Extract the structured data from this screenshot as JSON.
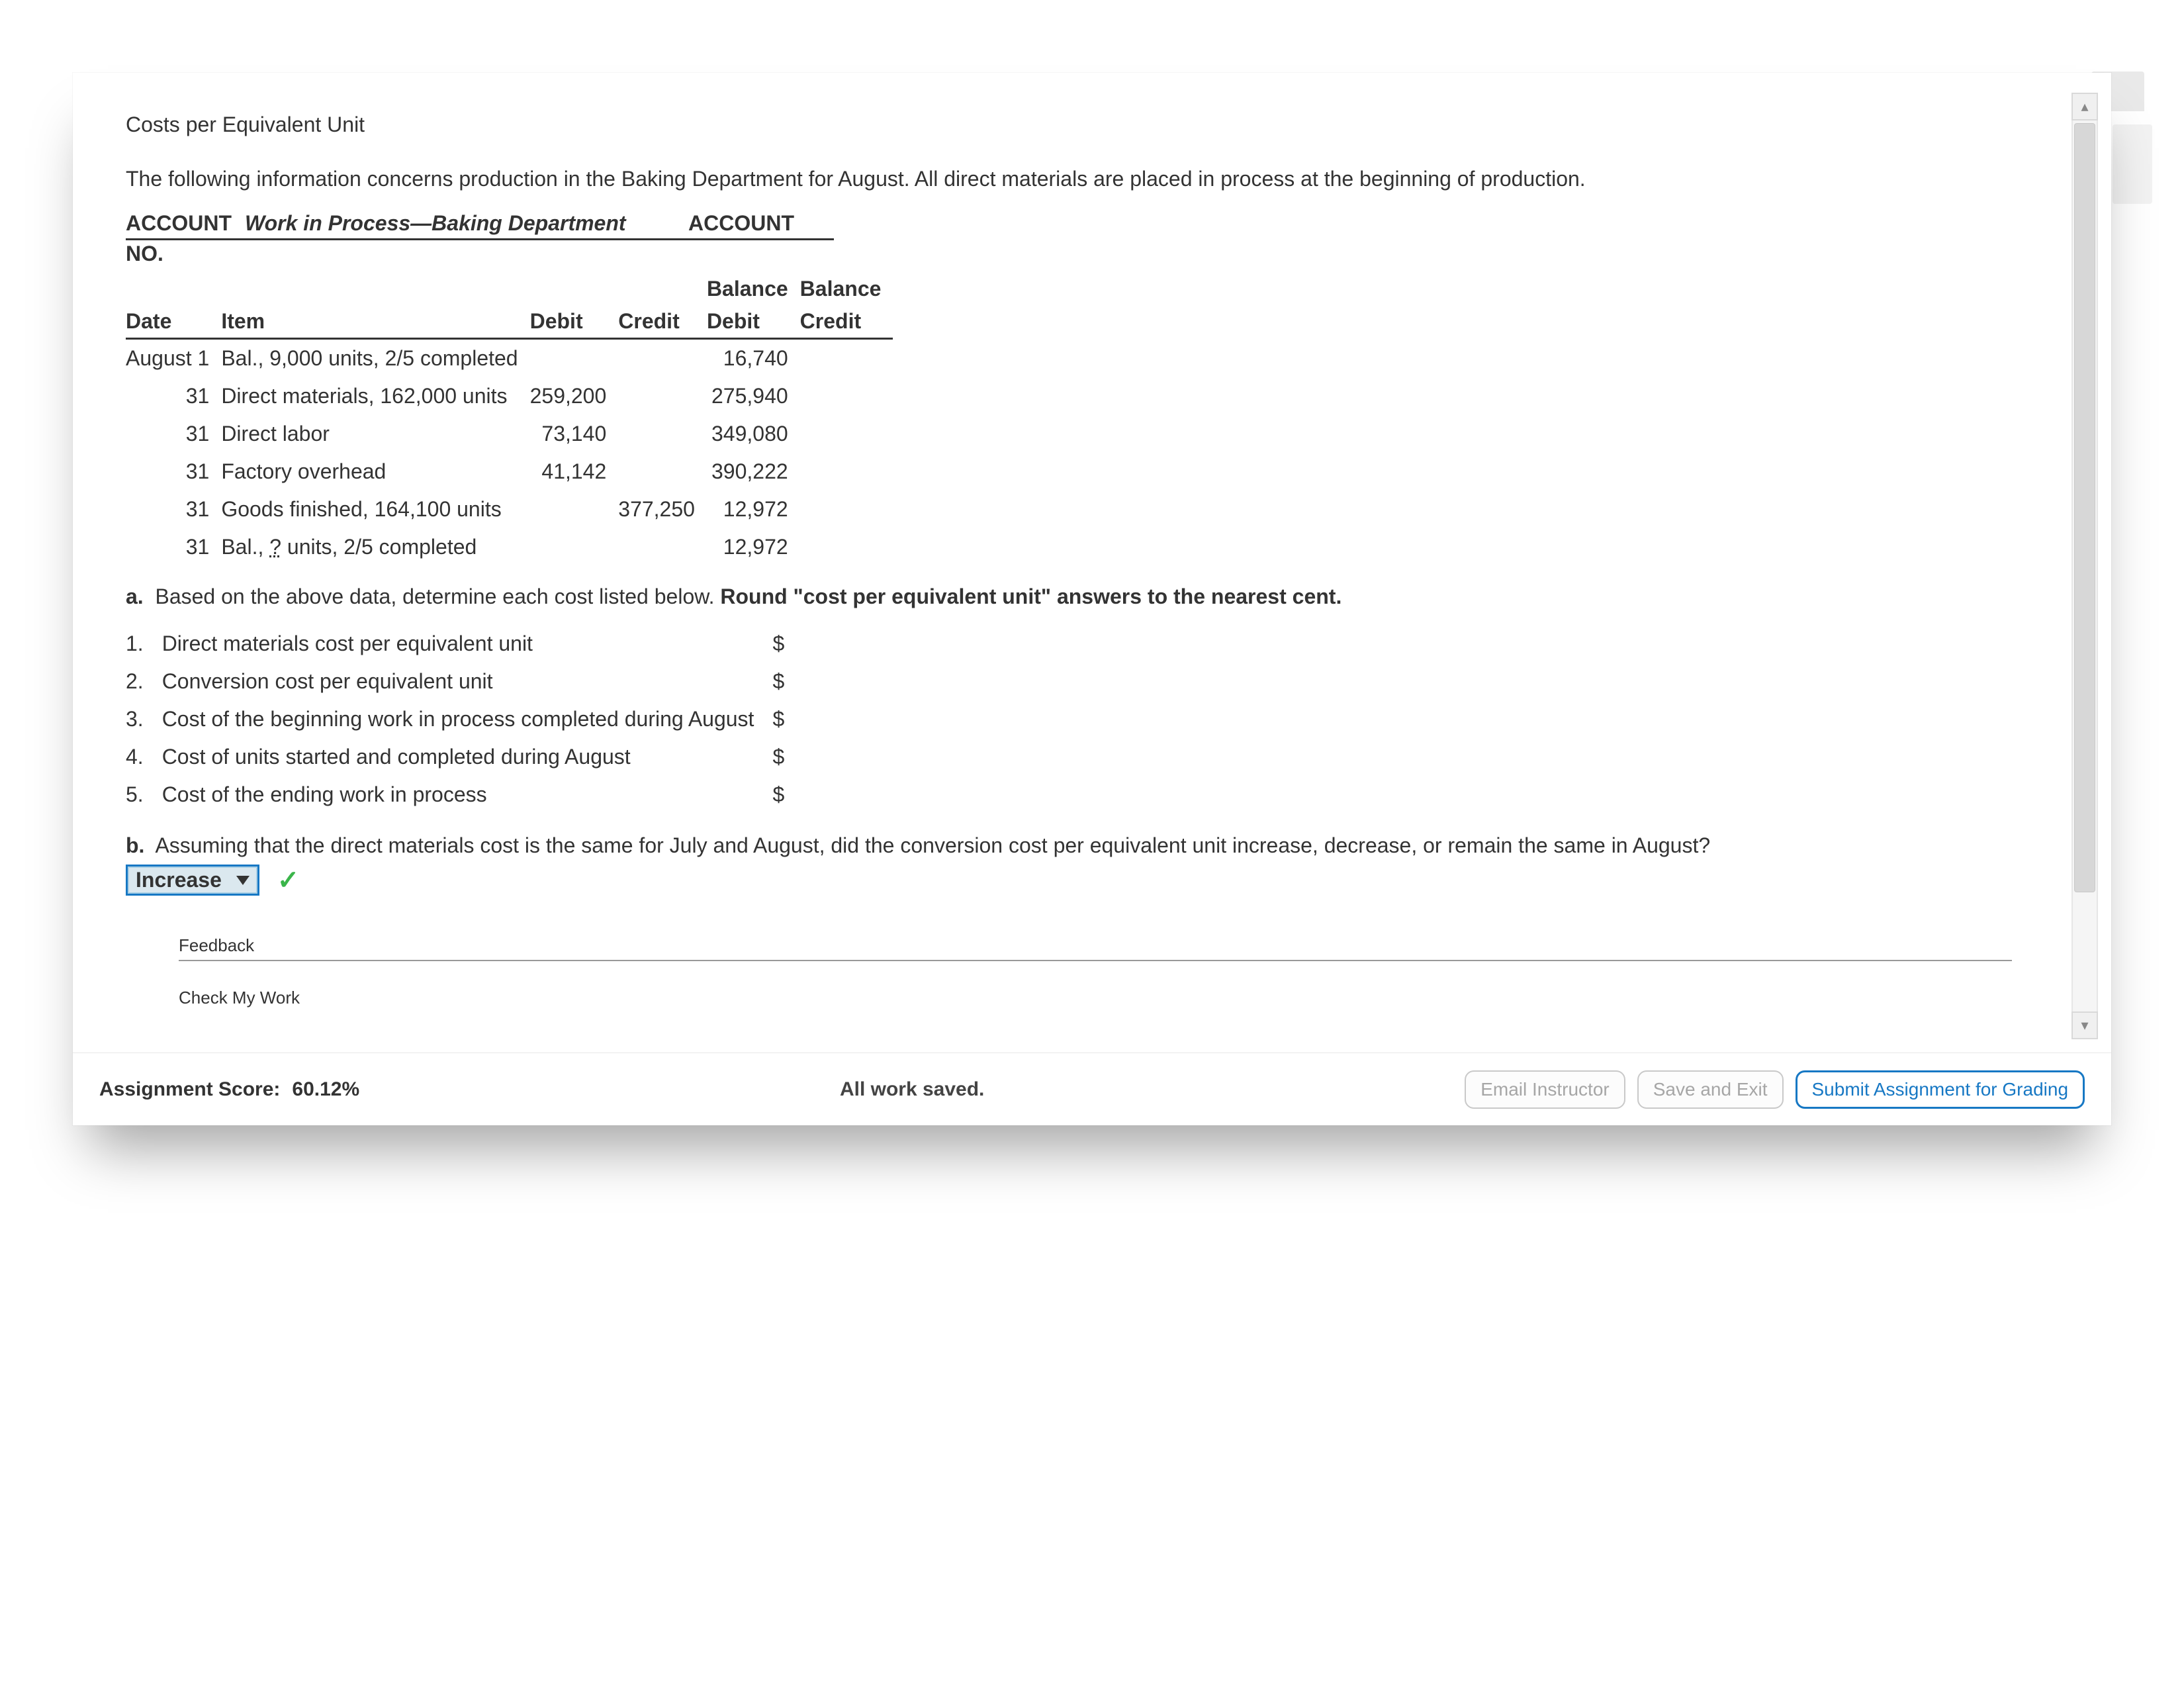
{
  "title": "Costs per Equivalent Unit",
  "intro": "The following information concerns production in the Baking Department for August. All direct materials are placed in process at the beginning of production.",
  "ledger": {
    "account_label": "ACCOUNT",
    "account_name": "Work in Process—Baking Department",
    "account_no_label": "ACCOUNT",
    "account_no_sub": "NO.",
    "cols": {
      "date": "Date",
      "item": "Item",
      "debit": "Debit",
      "credit": "Credit",
      "bal_debit_top": "Balance",
      "bal_debit": "Debit",
      "bal_credit_top": "Balance",
      "bal_credit": "Credit"
    },
    "rows": [
      {
        "date": "August 1",
        "item": "Bal., 9,000 units, 2/5 completed",
        "debit": "",
        "credit": "",
        "bdebit": "16,740",
        "bcredit": ""
      },
      {
        "date": "31",
        "item": "Direct materials, 162,000 units",
        "debit": "259,200",
        "credit": "",
        "bdebit": "275,940",
        "bcredit": ""
      },
      {
        "date": "31",
        "item": "Direct labor",
        "debit": "73,140",
        "credit": "",
        "bdebit": "349,080",
        "bcredit": ""
      },
      {
        "date": "31",
        "item": "Factory overhead",
        "debit": "41,142",
        "credit": "",
        "bdebit": "390,222",
        "bcredit": ""
      },
      {
        "date": "31",
        "item": "Goods finished, 164,100 units",
        "debit": "",
        "credit": "377,250",
        "bdebit": "12,972",
        "bcredit": ""
      },
      {
        "date": "31",
        "item_prefix": "Bal., ",
        "item_q": "?",
        "item_suffix": " units, 2/5 completed",
        "debit": "",
        "credit": "",
        "bdebit": "12,972",
        "bcredit": ""
      }
    ]
  },
  "part_a": {
    "label": "a.",
    "text_plain": "Based on the above data, determine each cost listed below. ",
    "text_bold": "Round \"cost per equivalent unit\" answers to the nearest cent.",
    "items": [
      {
        "n": "1.",
        "label": "Direct materials cost per equivalent unit",
        "value": "$"
      },
      {
        "n": "2.",
        "label": "Conversion cost per equivalent unit",
        "value": "$"
      },
      {
        "n": "3.",
        "label": "Cost of the beginning work in process completed during August",
        "value": "$"
      },
      {
        "n": "4.",
        "label": "Cost of units started and completed during August",
        "value": "$"
      },
      {
        "n": "5.",
        "label": "Cost of the ending work in process",
        "value": "$"
      }
    ]
  },
  "part_b": {
    "label": "b.",
    "text": "Assuming that the direct materials cost is the same for July and August, did the conversion cost per equivalent unit increase, decrease, or remain the same in August?",
    "selected": "Increase",
    "correct": true
  },
  "feedback": {
    "title": "Feedback",
    "check": "Check My Work"
  },
  "footer": {
    "score_label": "Assignment Score:",
    "score_value": "60.12%",
    "saved": "All work saved.",
    "buttons": {
      "email": "Email Instructor",
      "save": "Save and Exit",
      "submit": "Submit Assignment for Grading"
    }
  },
  "scroll": {
    "up": "▴",
    "down": "▾"
  }
}
